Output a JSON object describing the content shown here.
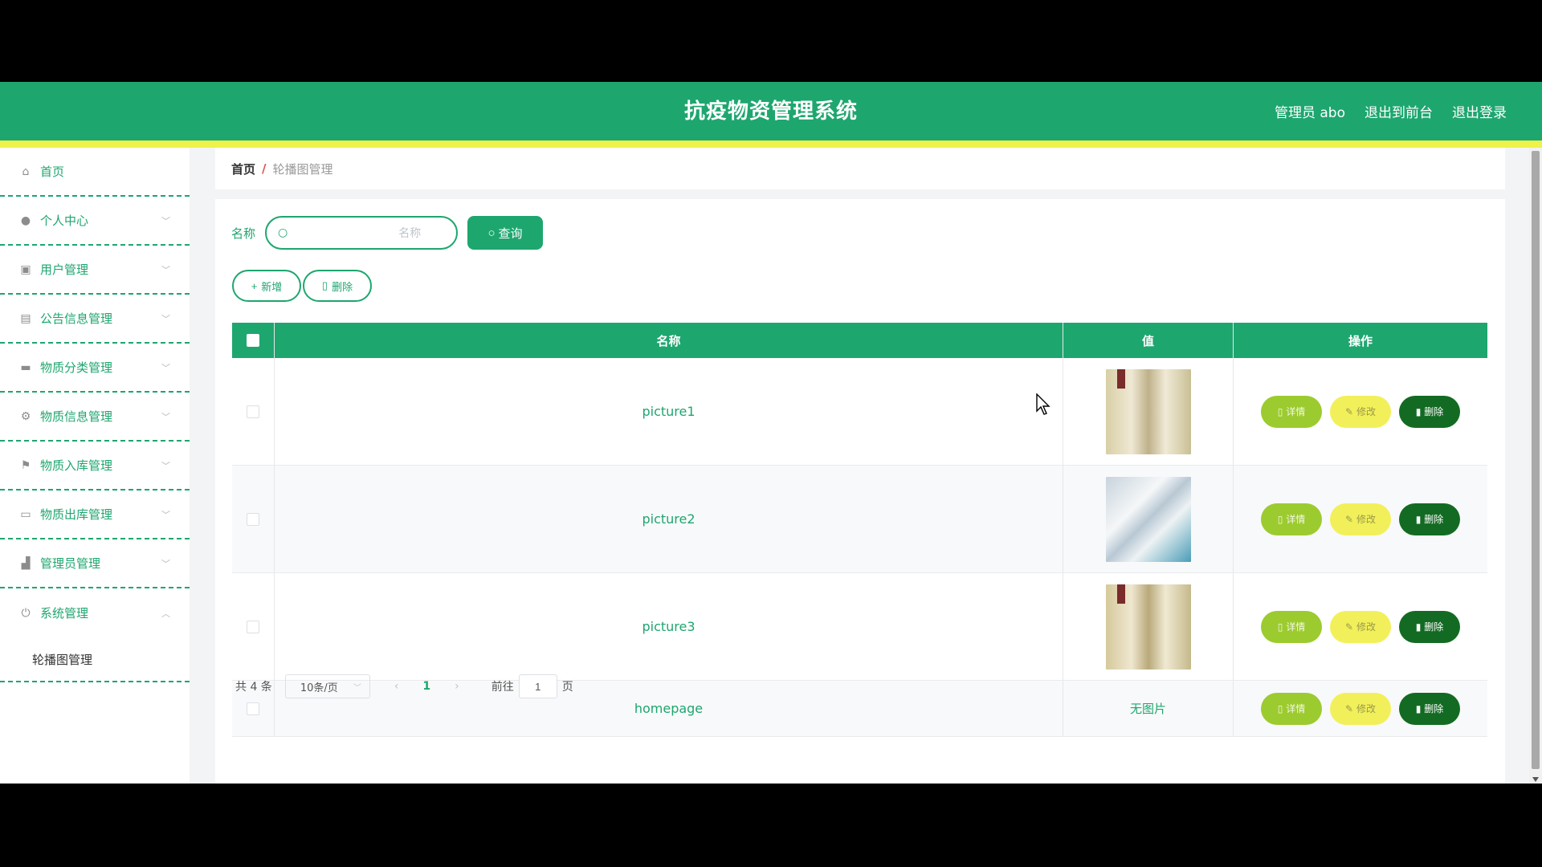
{
  "header": {
    "title": "抗疫物资管理系统",
    "user": "管理员 abo",
    "back_front": "退出到前台",
    "logout": "退出登录"
  },
  "sidebar": {
    "items": [
      {
        "label": "首页",
        "icon": "home-icon"
      },
      {
        "label": "个人中心",
        "icon": "user-icon"
      },
      {
        "label": "用户管理",
        "icon": "chart-icon"
      },
      {
        "label": "公告信息管理",
        "icon": "clipboard-icon"
      },
      {
        "label": "物质分类管理",
        "icon": "briefcase-icon"
      },
      {
        "label": "物质信息管理",
        "icon": "settings-icon"
      },
      {
        "label": "物质入库管理",
        "icon": "flag-icon"
      },
      {
        "label": "物质出库管理",
        "icon": "message-icon"
      },
      {
        "label": "管理员管理",
        "icon": "tools-icon"
      },
      {
        "label": "系统管理",
        "icon": "power-icon"
      }
    ],
    "sub_item": "轮播图管理"
  },
  "breadcrumb": {
    "home": "首页",
    "sep": "/",
    "current": "轮播图管理"
  },
  "search": {
    "label": "名称",
    "placeholder": "名称",
    "value": "",
    "button": "查询"
  },
  "actions": {
    "add": "新增",
    "delete": "删除"
  },
  "table": {
    "headers": [
      "名称",
      "值",
      "操作"
    ],
    "rows": [
      {
        "name": "picture1",
        "value_type": "image"
      },
      {
        "name": "picture2",
        "value_type": "image"
      },
      {
        "name": "picture3",
        "value_type": "image"
      },
      {
        "name": "homepage",
        "value_text": "无图片"
      }
    ],
    "op_detail": "详情",
    "op_edit": "修改",
    "op_delete": "删除"
  },
  "pager": {
    "total": "共 4 条",
    "page_size": "10条/页",
    "current_page": "1",
    "goto": "前往",
    "goto_value": "1",
    "unit": "页"
  },
  "colors": {
    "primary": "#1ea66f",
    "accent_yellow": "#eef24a",
    "detail": "#9ccb2f",
    "edit": "#f2f05a",
    "delete": "#136b23"
  }
}
